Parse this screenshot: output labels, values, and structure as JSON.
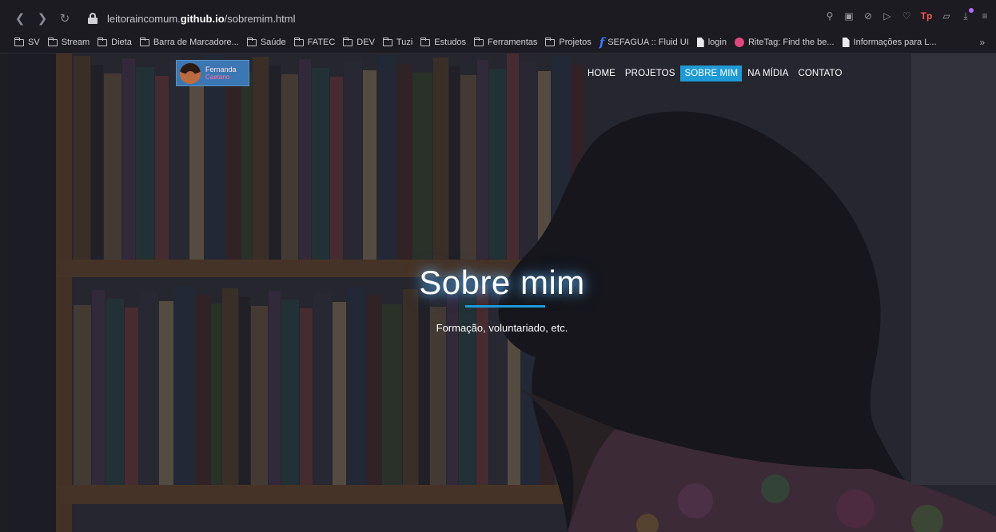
{
  "browser": {
    "url_prefix": "leitoraincomum.",
    "url_domain": "github.io",
    "url_path": "/sobremim.html",
    "bookmarks": [
      {
        "label": "SV",
        "icon": "folder-icon"
      },
      {
        "label": "Stream",
        "icon": "folder-icon"
      },
      {
        "label": "Dieta",
        "icon": "folder-icon"
      },
      {
        "label": "Barra de Marcadore...",
        "icon": "folder-icon"
      },
      {
        "label": "Saúde",
        "icon": "folder-icon"
      },
      {
        "label": "FATEC",
        "icon": "folder-icon"
      },
      {
        "label": "DEV",
        "icon": "folder-icon"
      },
      {
        "label": "Tuzi",
        "icon": "folder-icon"
      },
      {
        "label": "Estudos",
        "icon": "folder-icon"
      },
      {
        "label": "Ferramentas",
        "icon": "folder-icon"
      },
      {
        "label": "Projetos",
        "icon": "folder-icon"
      },
      {
        "label": "SEFAGUA :: Fluid UI",
        "icon": "fluid-ui-logo-icon"
      },
      {
        "label": "login",
        "icon": "document-icon"
      },
      {
        "label": "RiteTag: Find the be...",
        "icon": "ritetag-icon"
      },
      {
        "label": "Informações para L...",
        "icon": "document-icon"
      }
    ],
    "more_label": "»",
    "extension_tp_label": "Tp"
  },
  "page": {
    "logo": {
      "name": "Fernanda",
      "sub": "Caetano"
    },
    "nav": [
      {
        "label": "HOME",
        "active": false
      },
      {
        "label": "PROJETOS",
        "active": false
      },
      {
        "label": "SOBRE MIM",
        "active": true
      },
      {
        "label": "NA MÍDIA",
        "active": false
      },
      {
        "label": "CONTATO",
        "active": false
      }
    ],
    "title": "Sobre mim",
    "subtitle": "Formação, voluntariado, etc."
  },
  "colors": {
    "accent": "#1e9ad6",
    "chrome_bg": "#1b1b21"
  }
}
